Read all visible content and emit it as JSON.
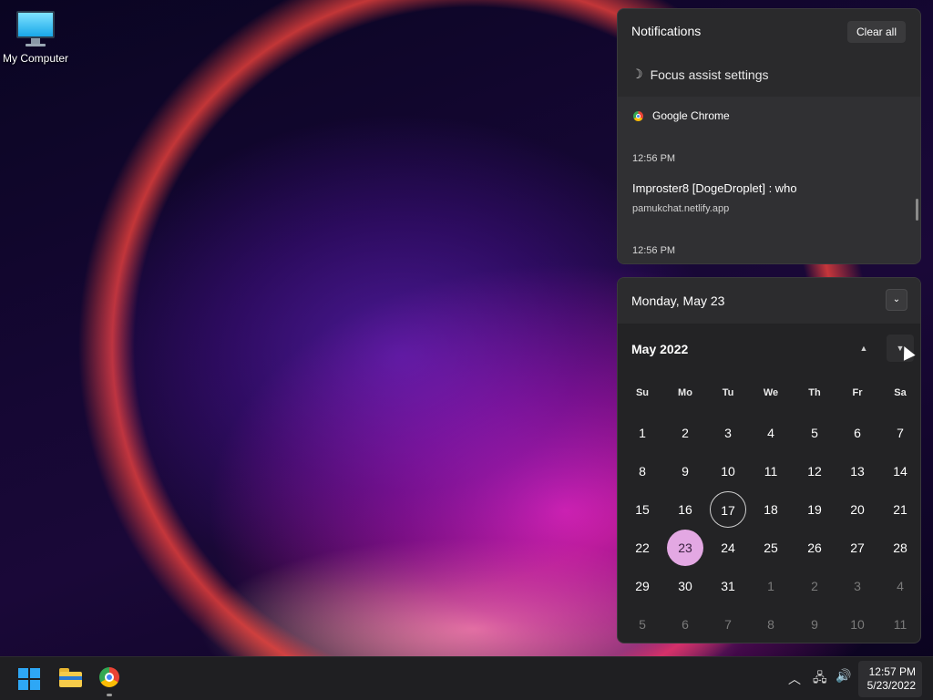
{
  "desktop": {
    "icons": [
      {
        "label": "My Computer",
        "icon": "monitor-icon"
      }
    ]
  },
  "notifications": {
    "header": "Notifications",
    "clear_all_label": "Clear all",
    "focus_assist_label": "Focus assist settings",
    "card": {
      "app_name": "Google Chrome",
      "time_first": "12:56 PM",
      "title": "Improster8 [DogeDroplet] : who",
      "source": "pamukchat.netlify.app",
      "time_second": "12:56 PM"
    }
  },
  "calendar": {
    "date_header": "Monday, May 23",
    "month_label": "May 2022",
    "weekdays": [
      "Su",
      "Mo",
      "Tu",
      "We",
      "Th",
      "Fr",
      "Sa"
    ],
    "weeks": [
      [
        1,
        2,
        3,
        4,
        5,
        6,
        7
      ],
      [
        8,
        9,
        10,
        11,
        12,
        13,
        14
      ],
      [
        15,
        16,
        17,
        18,
        19,
        20,
        21
      ],
      [
        22,
        23,
        24,
        25,
        26,
        27,
        28
      ],
      [
        29,
        30,
        31,
        1,
        2,
        3,
        4
      ],
      [
        5,
        6,
        7,
        8,
        9,
        10,
        11
      ]
    ],
    "outlined_day": 17,
    "selected_day": 23,
    "accent_color": "#e3a8e3"
  },
  "taskbar": {
    "pinned": [
      "windows-start-icon",
      "file-explorer-icon",
      "chrome-icon"
    ],
    "tray_icons": [
      "chevron-up-icon",
      "network-icon",
      "volume-icon"
    ],
    "clock_time": "12:57 PM",
    "clock_date": "5/23/2022"
  }
}
